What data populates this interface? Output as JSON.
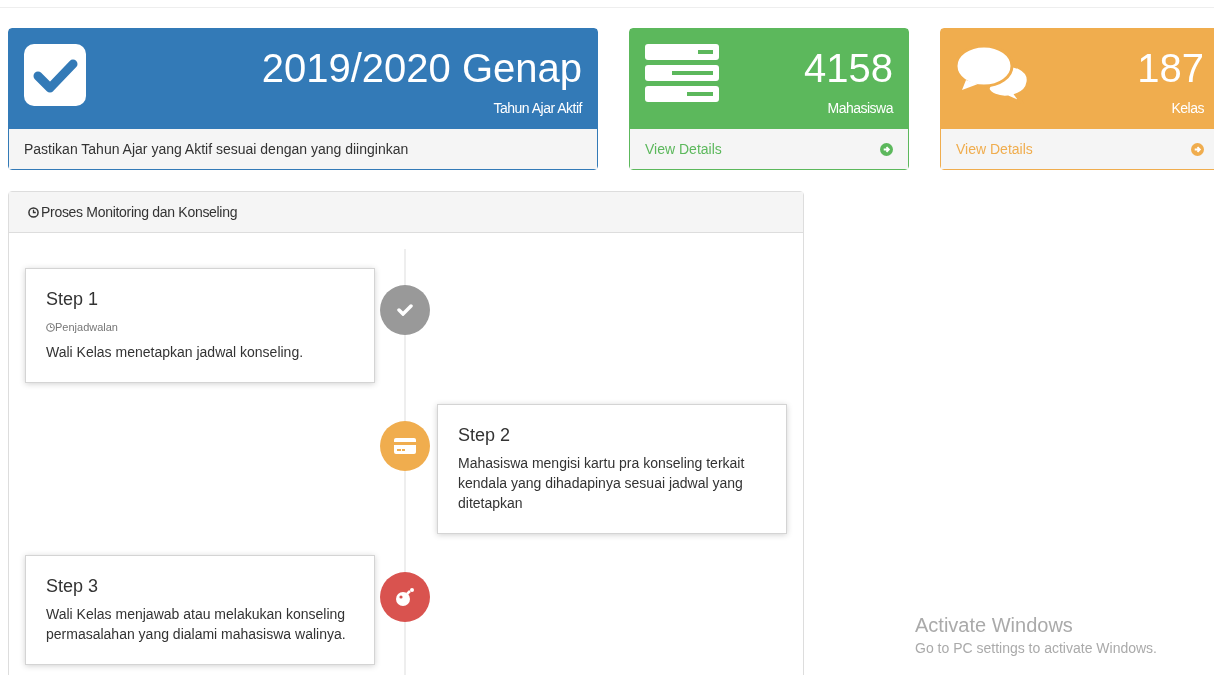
{
  "stats": [
    {
      "kind": "check",
      "color": "#337ab7",
      "value": "2019/2020 Genap",
      "label": "Tahun Ajar Aktif",
      "footer": "Pastikan Tahun Ajar yang Aktif sesuai dengan yang diinginkan"
    },
    {
      "kind": "list",
      "color": "#5cb85c",
      "value": "4158",
      "label": "Mahasiswa",
      "footer": "View Details"
    },
    {
      "kind": "chat",
      "color": "#f0ad4e",
      "value": "187",
      "label": "Kelas",
      "footer": "View Details"
    }
  ],
  "panel": {
    "title": "Proses Monitoring dan Konseling",
    "steps": [
      {
        "kind": "check",
        "color": "#999999",
        "title": "Step 1",
        "subtitle": "Penjadwalan",
        "text": "Wali Kelas menetapkan jadwal konseling."
      },
      {
        "kind": "card",
        "color": "#f0ad4e",
        "title": "Step 2",
        "text": "Mahasiswa mengisi kartu pra konseling terkait kendala yang dihadapinya sesuai jadwal yang ditetapkan"
      },
      {
        "kind": "bomb",
        "color": "#d9534f",
        "title": "Step 3",
        "text": "Wali Kelas menjawab atau melakukan konseling permasalahan yang dialami mahasiswa walinya."
      }
    ]
  },
  "system_notice": {
    "title": "Activate Windows",
    "subtitle": "Go to PC settings to activate Windows."
  }
}
